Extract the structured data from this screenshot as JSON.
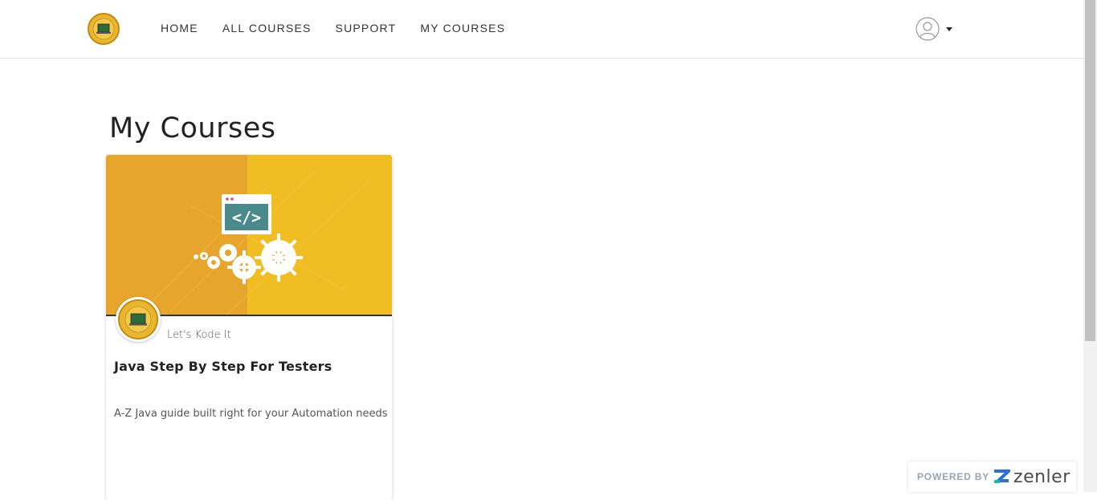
{
  "nav": {
    "links": [
      "HOME",
      "ALL COURSES",
      "SUPPORT",
      "MY COURSES"
    ]
  },
  "page": {
    "title": "My Courses"
  },
  "course": {
    "author": "Let's Kode It",
    "title": "Java Step By Step For Testers",
    "description": "A-Z Java guide built right for your Automation needs",
    "code_symbol": "</>"
  },
  "footer": {
    "powered_label": "POWERED BY",
    "brand": "zenler"
  },
  "colors": {
    "accent_yellow": "#f0b92a",
    "logo_gold": "#e9b62f",
    "code_teal": "#4a8a8c"
  }
}
